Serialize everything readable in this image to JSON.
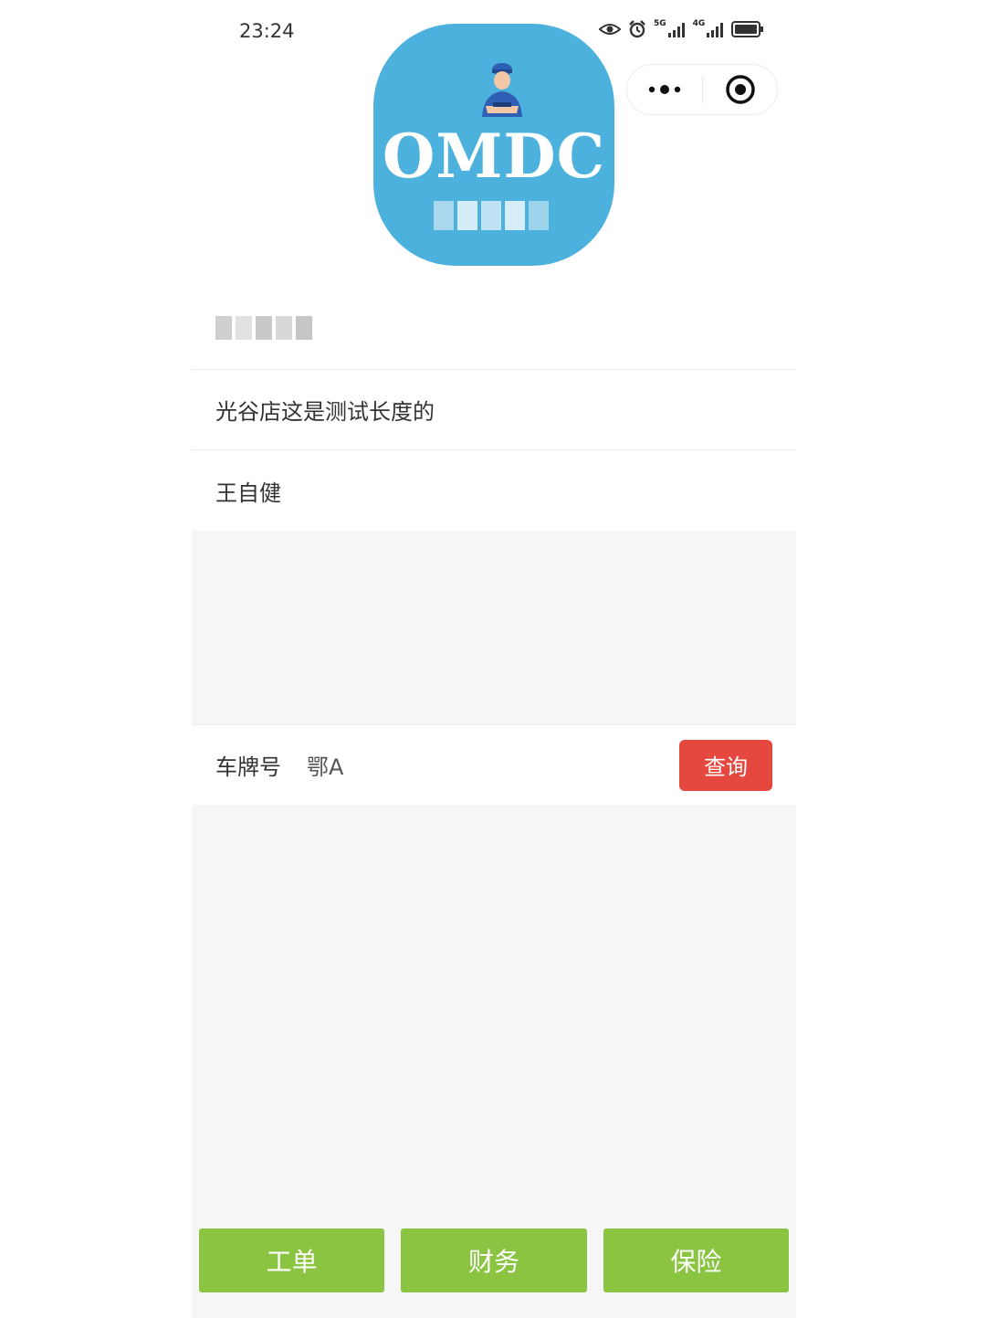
{
  "status_bar": {
    "time": "23:24",
    "net_5g_label": "5G",
    "net_4g_label": "4G",
    "icons": [
      "eye-icon",
      "alarm-icon",
      "signal-5g-icon",
      "signal-4g-icon",
      "battery-icon"
    ]
  },
  "capsule": {
    "more_icon": "more-dots-icon",
    "close_icon": "target-icon"
  },
  "logo": {
    "text": "OMDC",
    "background": "#4cb2dd"
  },
  "info": {
    "store": "光谷店这是测试长度的",
    "staff": "王自健"
  },
  "plate": {
    "label": "车牌号",
    "value": "鄂A",
    "query_label": "查询",
    "query_color": "#e4483e"
  },
  "bottom_nav": {
    "color": "#8ac441",
    "items": [
      {
        "label": "工单"
      },
      {
        "label": "财务"
      },
      {
        "label": "保险"
      }
    ]
  }
}
